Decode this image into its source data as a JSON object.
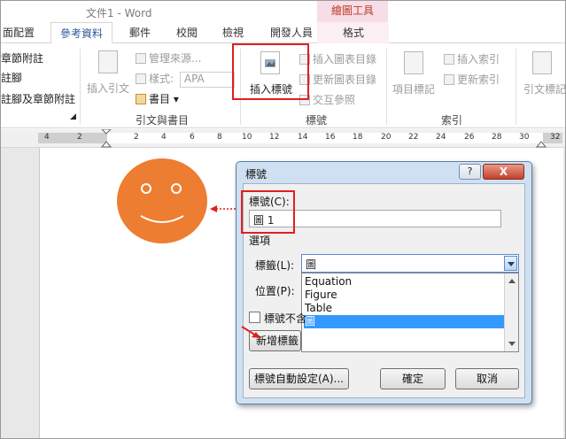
{
  "window": {
    "title": "文件1 - Word",
    "contextual_tab_group": "繪圖工具",
    "contextual_tab": "格式"
  },
  "tabs": [
    "面配置",
    "參考資料",
    "郵件",
    "校閱",
    "檢視",
    "開發人員"
  ],
  "active_tab": "參考資料",
  "ribbon": {
    "footnotes": {
      "items": [
        "章節附註",
        "註腳",
        "註腳及章節附註"
      ]
    },
    "citations": {
      "insert_citation": "插入引文",
      "manage_sources": "管理來源...",
      "style_label": "樣式:",
      "style_value": "APA",
      "bibliography": "書目",
      "group_label": "引文與書目"
    },
    "captions": {
      "insert_caption": "插入標號",
      "insert_table_of_figures": "插入圖表目錄",
      "update_table": "更新圖表目錄",
      "cross_reference": "交互參照",
      "group_label": "標號"
    },
    "index": {
      "mark_entry": "項目標記",
      "insert_index": "插入索引",
      "update_index": "更新索引",
      "group_label": "索引"
    },
    "toa": {
      "mark_citation": "引文標記"
    }
  },
  "ruler": {
    "numbers": [
      "4",
      "2",
      "2",
      "4",
      "6",
      "8",
      "10",
      "12",
      "14",
      "16",
      "18",
      "20",
      "22",
      "24",
      "26",
      "28",
      "30",
      "32"
    ]
  },
  "dialog": {
    "title": "標號",
    "help": "?",
    "close": "X",
    "caption_label": "標號(C):",
    "caption_value": "圖 1",
    "options_label": "選項",
    "label_label": "標籤(L):",
    "label_value": "圖",
    "position_label": "位置(P):",
    "exclude_label_text": "標號不含",
    "new_label_button": "新增標籤",
    "label_options": [
      "Equation",
      "Figure",
      "Table",
      "圖"
    ],
    "selected_option": "圖",
    "autocaption_button": "標號自動設定(A)...",
    "ok_button": "確定",
    "cancel_button": "取消"
  },
  "colors": {
    "highlight_red": "#e02020",
    "smiley_orange": "#ed7d31",
    "selection_blue": "#3399ff",
    "tab_accent": "#2b579a"
  }
}
